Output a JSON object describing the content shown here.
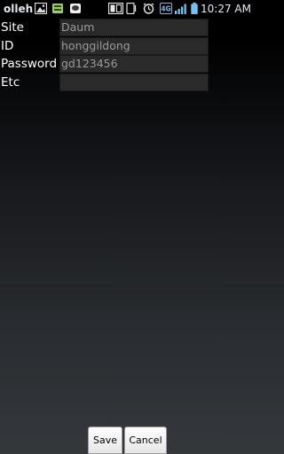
{
  "status_bar": {
    "carrier": "olleh",
    "time": "10:27 AM",
    "network": "4G"
  },
  "form": {
    "fields": [
      {
        "label": "Site",
        "value": "Daum"
      },
      {
        "label": "ID",
        "value": "honggildong"
      },
      {
        "label": "Password",
        "value": "gd123456"
      },
      {
        "label": "Etc",
        "value": ""
      }
    ]
  },
  "buttons": {
    "save": "Save",
    "cancel": "Cancel"
  }
}
